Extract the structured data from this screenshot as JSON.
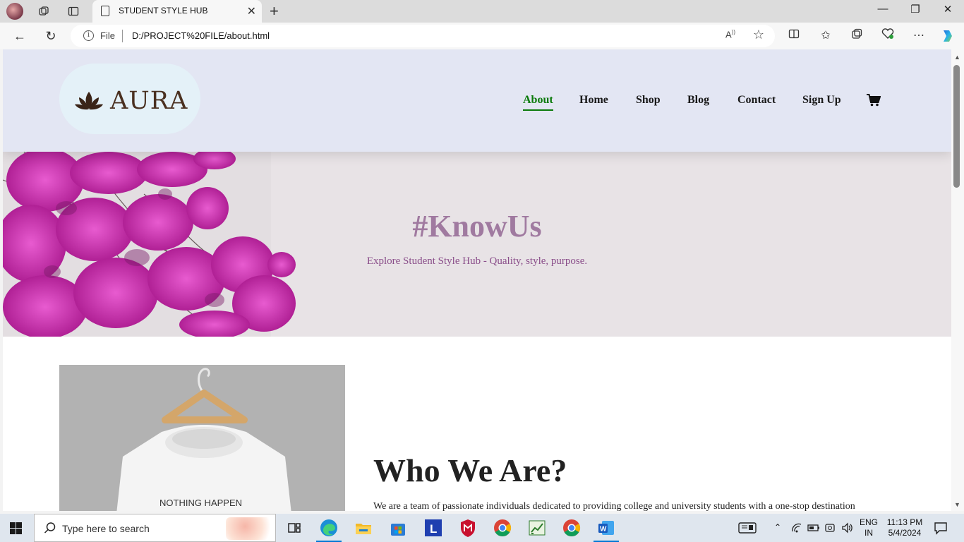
{
  "browser": {
    "tab_title": "STUDENT STYLE HUB",
    "address_prefix": "File",
    "url": "D:/PROJECT%20FILE/about.html"
  },
  "site": {
    "logo_text": "AURA",
    "nav": [
      {
        "label": "About",
        "active": true
      },
      {
        "label": "Home"
      },
      {
        "label": "Shop"
      },
      {
        "label": "Blog"
      },
      {
        "label": "Contact"
      },
      {
        "label": "Sign Up"
      }
    ],
    "cart_icon": "cart-icon",
    "hero": {
      "heading": "#KnowUs",
      "subheading": "Explore Student Style Hub - Quality, style, purpose."
    },
    "about": {
      "image_caption_text": "NOTHING HAPPEN",
      "heading": "Who We Are?",
      "paragraph": "We are a team of passionate individuals dedicated to providing college and university students with a one-stop destination"
    }
  },
  "taskbar": {
    "search_placeholder": "Type here to search",
    "lang_top": "ENG",
    "lang_bottom": "IN",
    "time": "11:13 PM",
    "date": "5/4/2024"
  },
  "colors": {
    "header_bg": "#e3e6f3",
    "active_nav": "#0a7a0a",
    "hero_heading": "#a07aa0",
    "hero_sub": "#8a4e8a"
  }
}
